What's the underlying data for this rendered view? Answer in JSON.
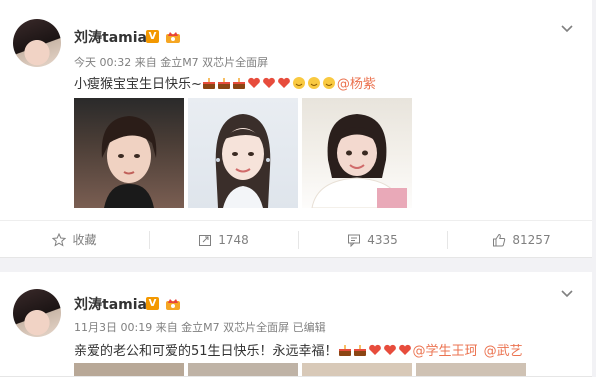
{
  "posts": [
    {
      "author": "刘涛tamia",
      "verified_badge": "V",
      "meta": "今天 00:32 来自 金立M7 双芯片全面屏",
      "text": "小瘦猴宝宝生日快乐~",
      "mention": "@杨紫",
      "actions": {
        "favorite": "收藏",
        "repost": "1748",
        "comment": "4335",
        "like": "81257"
      }
    },
    {
      "author": "刘涛tamia",
      "verified_badge": "V",
      "meta": "11月3日 00:19 来自 金立M7 双芯片全面屏  已编辑",
      "text": "亲爱的老公和可爱的51生日快乐！永远幸福！",
      "mention": "@学生王珂",
      "mention2": "@武艺"
    }
  ],
  "icons": {
    "verified": "v-badge-icon",
    "vip": "crown-icon",
    "menu": "chevron-down-icon",
    "favorite": "star-icon",
    "repost": "repost-icon",
    "comment": "comment-icon",
    "like": "thumbs-up-icon"
  },
  "colors": {
    "mention": "#eb7350",
    "badge": "#f39800",
    "heart": "#e74c3c",
    "cake": "#8b4513"
  }
}
